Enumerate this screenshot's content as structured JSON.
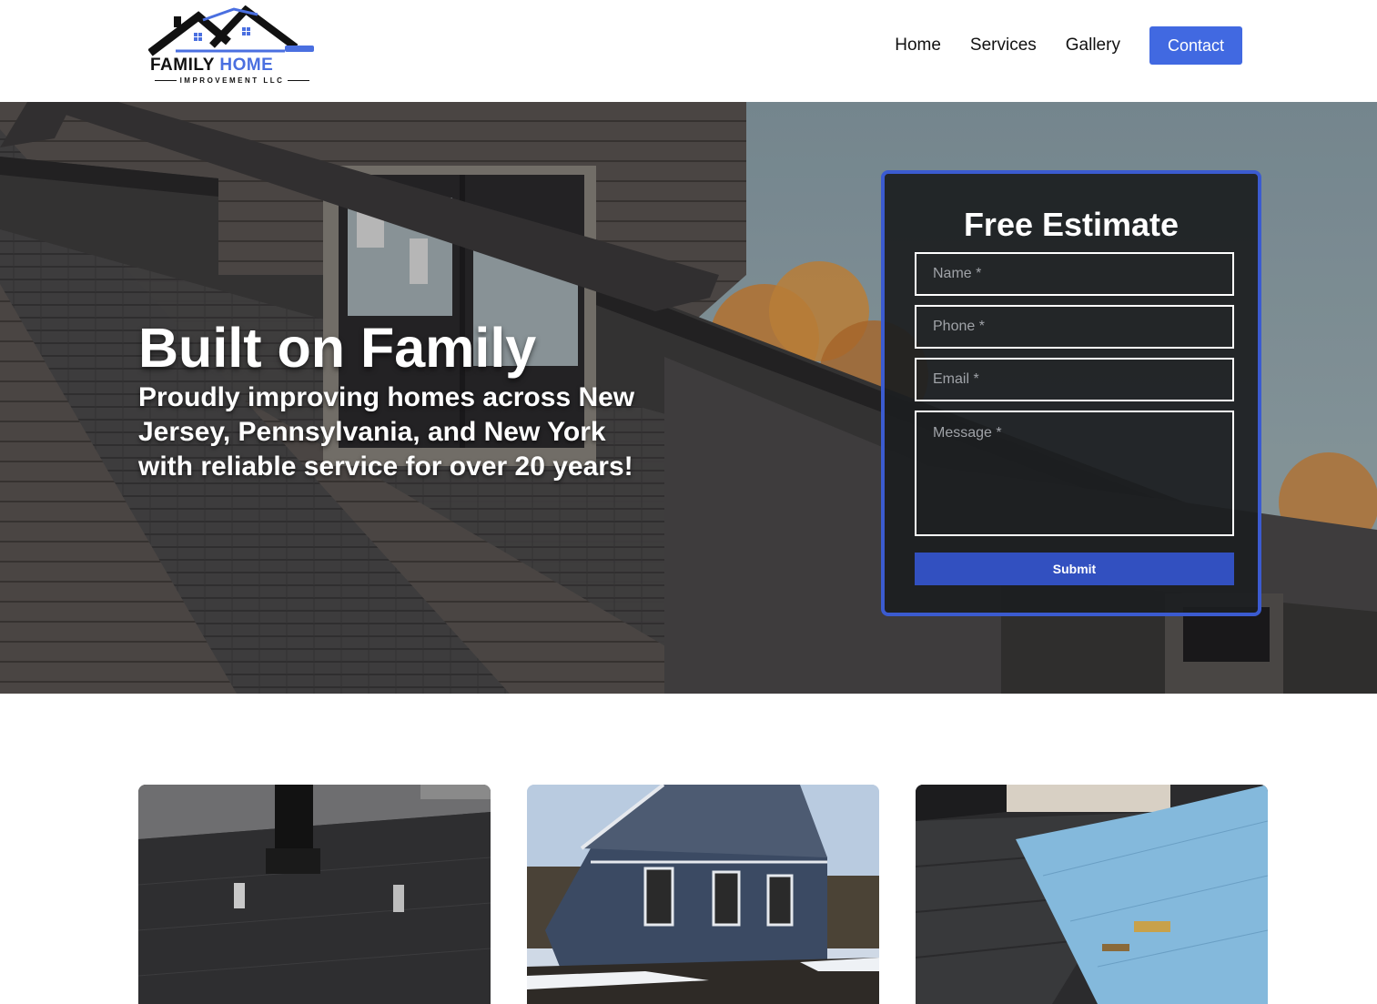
{
  "brand": {
    "name_part1": "FAMILY",
    "name_part2": "HOME",
    "tagline": "IMPROVEMENT LLC",
    "accent_color": "#4169e1",
    "icon": "house-roof-logo-icon"
  },
  "nav": {
    "items": [
      {
        "label": "Home"
      },
      {
        "label": "Services"
      },
      {
        "label": "Gallery"
      }
    ],
    "cta": "Contact"
  },
  "hero": {
    "title": "Built on Family",
    "subtitle": "Proudly improving homes across New Jersey, Pennsylvania, and New York with reliable service for over 20 years!"
  },
  "estimate_form": {
    "title": "Free Estimate",
    "name_placeholder": "Name *",
    "phone_placeholder": "Phone *",
    "email_placeholder": "Email *",
    "message_placeholder": "Message *",
    "submit_label": "Submit",
    "border_color": "#3b5bd0"
  },
  "gallery": {
    "images": [
      {
        "icon": "flat-roof-photo"
      },
      {
        "icon": "blue-siding-house-photo"
      },
      {
        "icon": "metal-roof-install-photo"
      }
    ]
  }
}
